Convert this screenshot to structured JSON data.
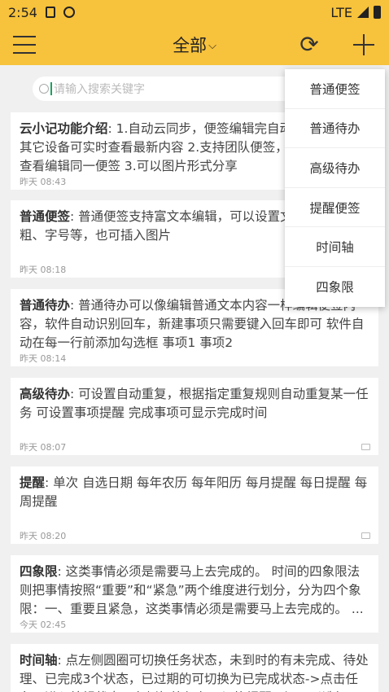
{
  "status_bar": {
    "time": "2:54",
    "network": "LTE"
  },
  "app_bar": {
    "title": "全部",
    "dropdown_arrow": "⌵",
    "menu_icon": "hamburger-icon",
    "refresh_icon": "sync-icon",
    "add_icon": "plus-icon"
  },
  "search": {
    "placeholder": "请输入搜索关键字"
  },
  "notes": [
    {
      "label": "云小记功能介绍",
      "text": ": 1.自动云同步，便签编辑完自动同步到云端，其它设备可实时查看最新内容 2.支持团队便签，不同账号共同查看编辑同一便签 3.可以图片形式分享",
      "time": "昨天 08:43"
    },
    {
      "label": "普通便签",
      "text": ": 普通便签支持富文本编辑，可以设置文字颜色、加粗、字号等，也可插入图片",
      "time": "昨天 08:18"
    },
    {
      "label": "普通待办",
      "text": ": 普通待办可以像编辑普通文本内容一样编辑便签内容，软件自动识别回车，新建事项只需要键入回车即可 软件自动在每一行前添加勾选框 事项1 事项2",
      "time": "昨天 08:14"
    },
    {
      "label": "高级待办",
      "text": ": 可设置自动重复，根据指定重复规则自动重复某一任务 可设置事项提醒 完成事项可显示完成时间",
      "time": "昨天 08:07"
    },
    {
      "label": "提醒",
      "text": ": 单次 自选日期 每年农历 每年阳历 每月提醒 每日提醒 每周提醒",
      "time": "昨天 08:20"
    },
    {
      "label": "四象限",
      "text": ": 这类事情必须是需要马上去完成的。 时间的四象限法则把事情按照“重要”和“紧急”两个维度进行划分，分为四个象限：一、重要且紧急，这类事情必须是需要马上去完成的。 ...",
      "time": "今天 02:45"
    },
    {
      "label": "时间轴",
      "text": ": 点左侧圆圈可切换任务状态，未到时的有未完成、待处理、已完成3个状态，已过期的可切换为已完成状态->点击任务可进入编辑状态，左侧标签颜色可切换提醒，还可以选择",
      "time": ""
    }
  ],
  "popup_menu": {
    "items": [
      {
        "label": "普通便签"
      },
      {
        "label": "普通待办"
      },
      {
        "label": "高级待办"
      },
      {
        "label": "提醒便签"
      },
      {
        "label": "时间轴"
      },
      {
        "label": "四象限"
      }
    ]
  }
}
